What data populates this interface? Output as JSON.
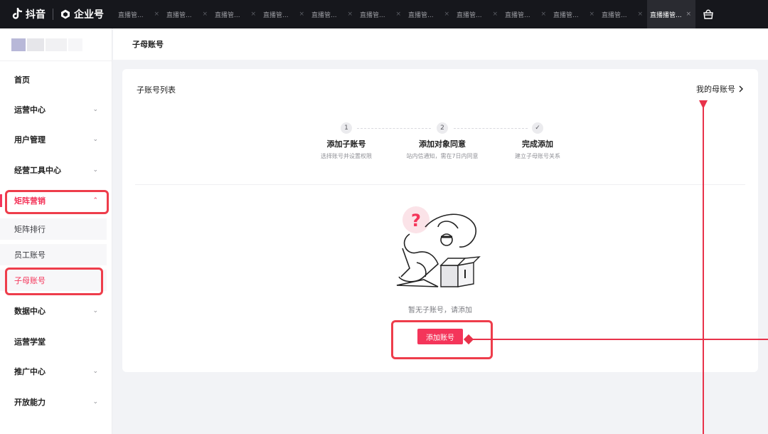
{
  "topbar": {
    "brand": "抖音",
    "enterprise": "企业号",
    "tabs": [
      {
        "label": "直播管..."
      },
      {
        "label": "直播管..."
      },
      {
        "label": "直播管..."
      },
      {
        "label": "直播管..."
      },
      {
        "label": "直播管..."
      },
      {
        "label": "直播管..."
      },
      {
        "label": "直播管..."
      },
      {
        "label": "直播管..."
      },
      {
        "label": "直播管..."
      },
      {
        "label": "直播管..."
      },
      {
        "label": "直播管..."
      },
      {
        "label": "直播播管...",
        "active": true
      }
    ],
    "close_glyph": "×"
  },
  "sidebar": {
    "items": [
      {
        "label": "首页"
      },
      {
        "label": "运营中心"
      },
      {
        "label": "用户管理"
      },
      {
        "label": "经营工具中心"
      },
      {
        "label": "矩阵营销",
        "expanded": true
      },
      {
        "label": "数据中心"
      },
      {
        "label": "运营学堂"
      },
      {
        "label": "推广中心"
      },
      {
        "label": "开放能力"
      }
    ],
    "sub_items": [
      {
        "label": "矩阵排行"
      },
      {
        "label": "员工账号"
      },
      {
        "label": "子母账号",
        "active": true
      }
    ],
    "chevron_down": "⌄",
    "chevron_up": "⌃"
  },
  "header": {
    "title": "子母账号"
  },
  "card": {
    "title": "子账号列表",
    "my_parent_link": "我的母账号",
    "steps": [
      {
        "num": "1",
        "title": "添加子账号",
        "desc": "选择账号并设置权限"
      },
      {
        "num": "2",
        "title": "添加对象同意",
        "desc": "站内信通知，需在7日内同意"
      },
      {
        "num": "✓",
        "title": "完成添加",
        "desc": "建立子母账号关系"
      }
    ],
    "empty_text": "暂无子账号，请添加",
    "add_button": "添加账号"
  },
  "colors": {
    "accent": "#f4355a",
    "annotation": "#ee3d4b",
    "topbar": "#16171c"
  },
  "icons": [
    "douyin-logo-icon",
    "enterprise-logo-icon",
    "close-icon",
    "shopping-bag-icon",
    "chevron-down-icon",
    "chevron-up-icon",
    "chevron-right-icon",
    "question-icon"
  ]
}
